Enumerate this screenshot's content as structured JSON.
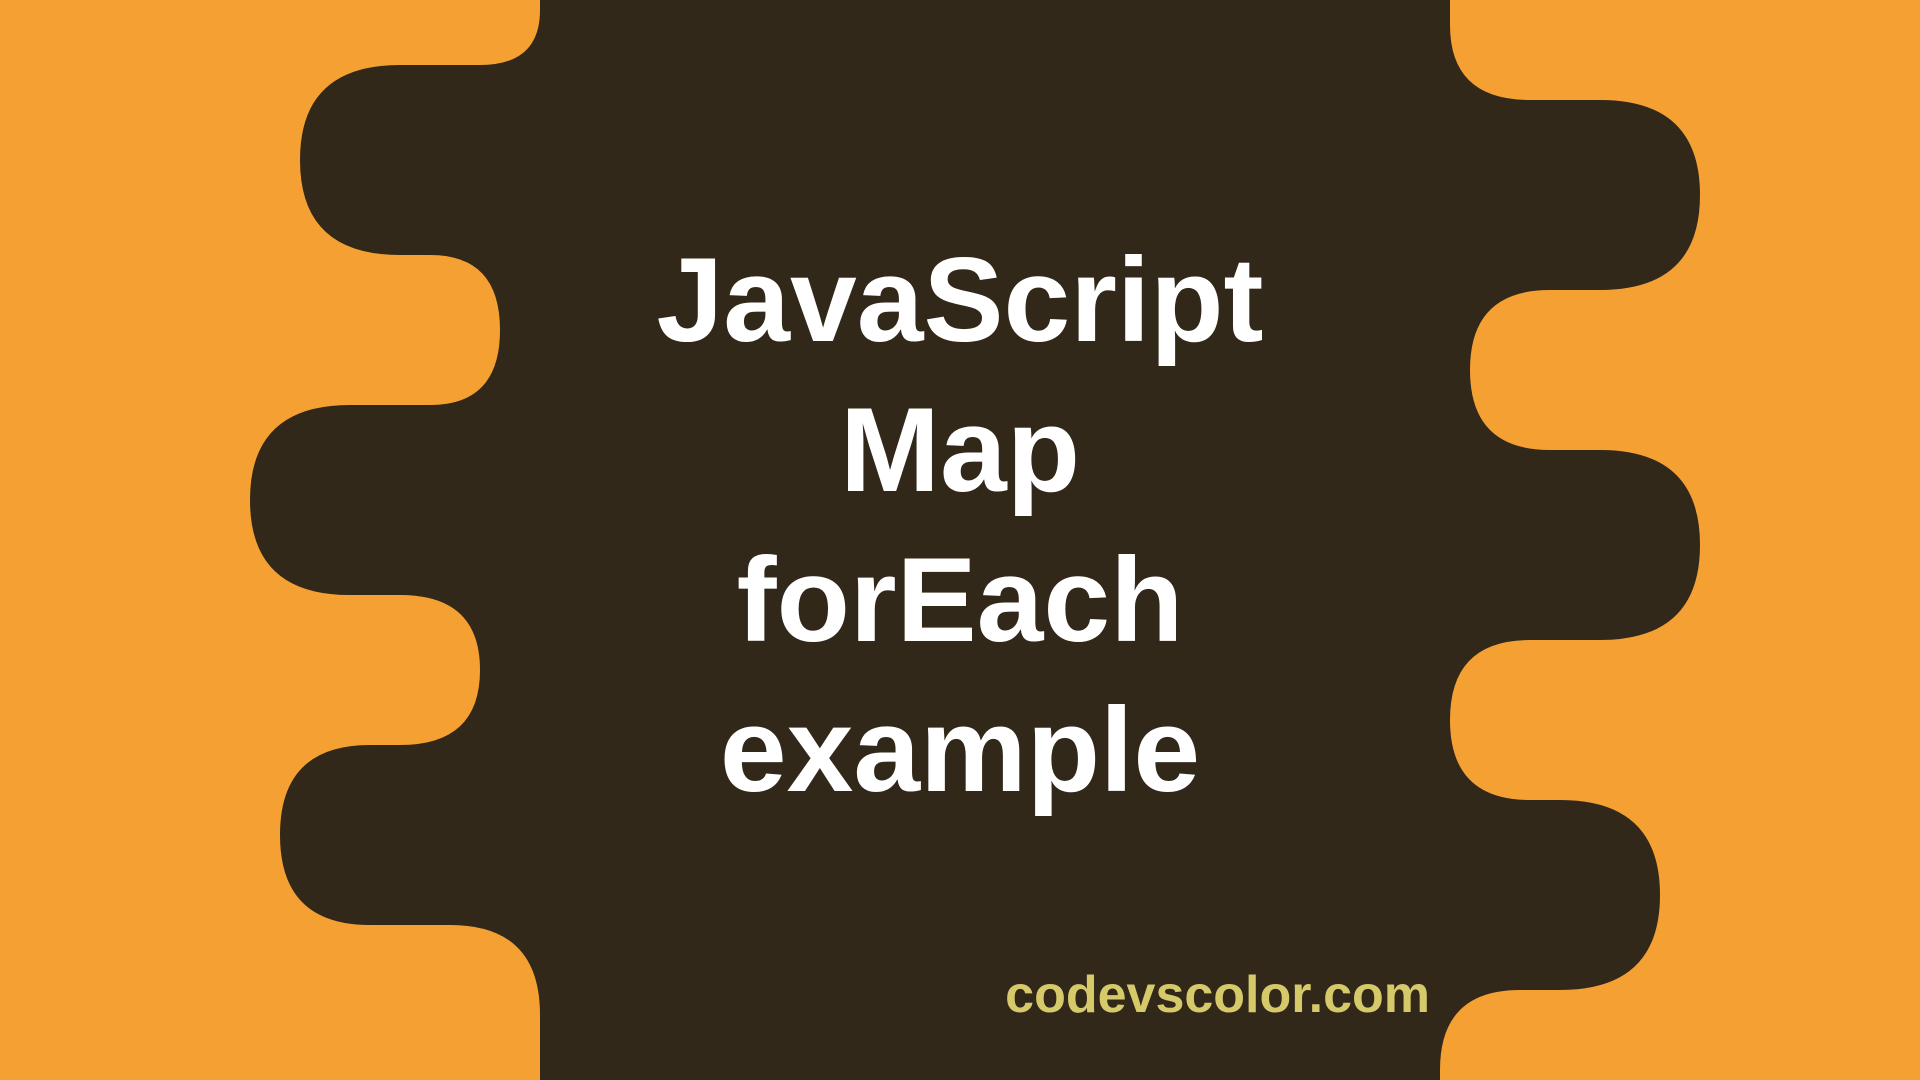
{
  "colors": {
    "background": "#f5a033",
    "blob": "#31281a",
    "title": "#ffffff",
    "watermark": "#d6c96a"
  },
  "title": {
    "line1": "JavaScript",
    "line2": "Map",
    "line3": "forEach",
    "line4": "example"
  },
  "watermark": "codevscolor.com"
}
